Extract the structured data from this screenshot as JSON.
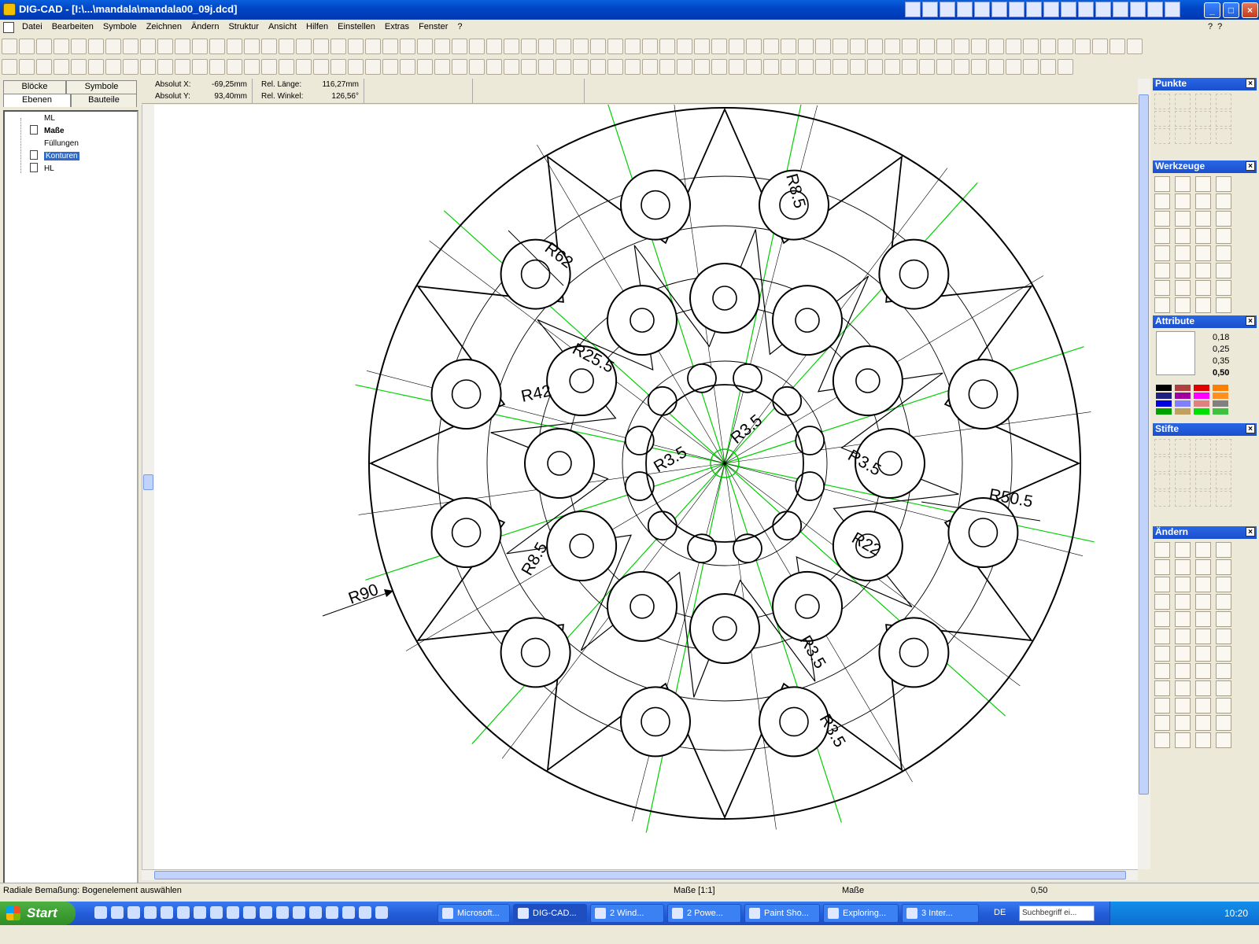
{
  "window": {
    "title": "DIG-CAD - [I:\\...\\mandala\\mandala00_09j.dcd]",
    "minimize_label": "_",
    "maximize_label": "□",
    "close_label": "×"
  },
  "menu": {
    "items": [
      "Datei",
      "Bearbeiten",
      "Symbole",
      "Zeichnen",
      "Ändern",
      "Struktur",
      "Ansicht",
      "Hilfen",
      "Einstellen",
      "Extras",
      "Fenster",
      "?"
    ],
    "help_icons": [
      "?",
      "?"
    ]
  },
  "left_panel": {
    "tabs_top": [
      "Blöcke",
      "Symbole"
    ],
    "tabs_bottom": [
      "Ebenen",
      "Bauteile"
    ],
    "layers": [
      {
        "label": "ML",
        "bold": false,
        "selected": false
      },
      {
        "label": "Maße",
        "bold": true,
        "selected": false
      },
      {
        "label": "Füllungen",
        "bold": false,
        "selected": false
      },
      {
        "label": "Konturen",
        "bold": false,
        "selected": true
      },
      {
        "label": "HL",
        "bold": false,
        "selected": false
      }
    ]
  },
  "coords": {
    "abs_x_label": "Absolut X:",
    "abs_x_value": "-69,25mm",
    "abs_y_label": "Absolut Y:",
    "abs_y_value": "93,40mm",
    "rel_len_label": "Rel. Länge:",
    "rel_len_value": "116,27mm",
    "rel_angle_label": "Rel. Winkel:",
    "rel_angle_value": "126,56°"
  },
  "drawing": {
    "dimensions": [
      "R8.5",
      "R62",
      "R25.5",
      "R42",
      "R3.5",
      "R3.5",
      "R3.5",
      "R50.5",
      "R22",
      "R8.5",
      "R3.5",
      "R90",
      "R3.5"
    ],
    "line_color": "#000000",
    "axis_color": "#00d000"
  },
  "palettes": {
    "punkte_title": "Punkte",
    "werkzeuge_title": "Werkzeuge",
    "attribute_title": "Attribute",
    "line_widths": [
      "0,18",
      "0,25",
      "0,35",
      "0,50"
    ],
    "stifte_title": "Stifte",
    "aendern_title": "Ändern",
    "color_swatches": [
      "#000000",
      "#b04040",
      "#e00000",
      "#ff8000",
      "#202080",
      "#a000a0",
      "#ff00ff",
      "#ff9020",
      "#0000e0",
      "#8080ff",
      "#e08080",
      "#808080",
      "#00a000",
      "#c0a060",
      "#00e000",
      "#40c040"
    ]
  },
  "status": {
    "message": "Radiale Bemaßung: Bogenelement auswählen",
    "layer_scale": "Maße [1:1]",
    "layer": "Maße",
    "line_width": "0,50"
  },
  "taskbar": {
    "start_label": "Start",
    "tasks": [
      {
        "label": "Microsoft...",
        "active": false
      },
      {
        "label": "DIG-CAD...",
        "active": true
      },
      {
        "label": "2 Wind...",
        "active": false
      },
      {
        "label": "2 Powe...",
        "active": false
      },
      {
        "label": "Paint Sho...",
        "active": false
      },
      {
        "label": "Exploring...",
        "active": false
      },
      {
        "label": "3 Inter...",
        "active": false
      }
    ],
    "language": "DE",
    "search_placeholder": "Suchbegriff ei...",
    "clock": "10:20"
  }
}
